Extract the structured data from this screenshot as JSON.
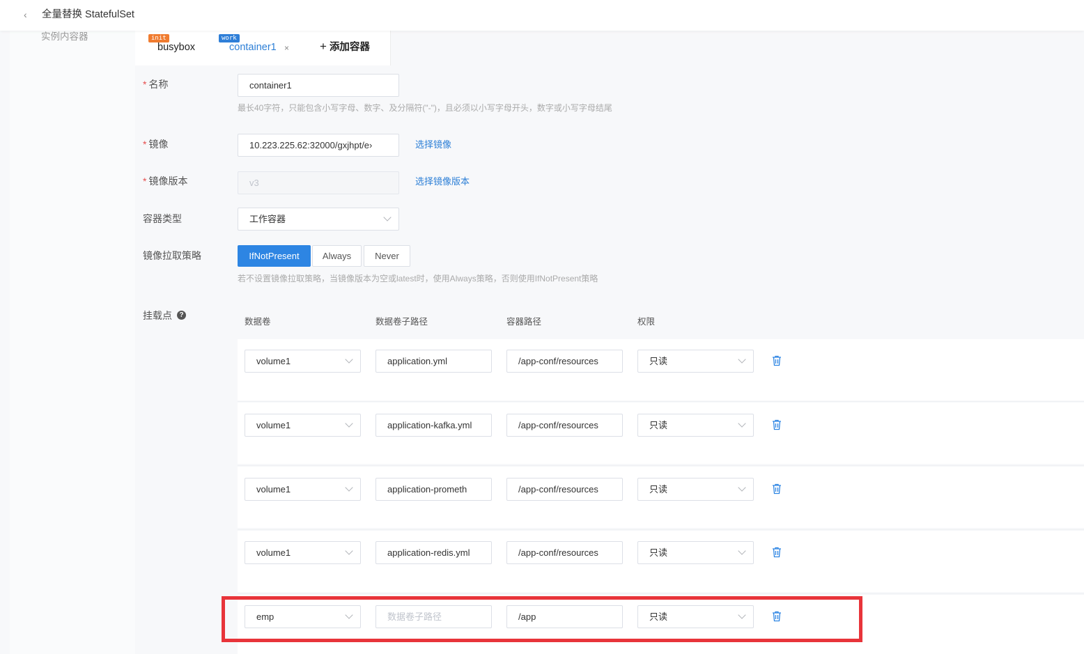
{
  "header": {
    "title": "全量替换 StatefulSet"
  },
  "left_nav": {
    "item": "实例内容器"
  },
  "tabs": [
    {
      "badge": "init",
      "label": "busybox",
      "badge_color": "#f07c30"
    },
    {
      "badge": "work",
      "label": "container1",
      "badge_color": "#2f7fd8",
      "close": "×"
    }
  ],
  "add_container": {
    "plus": "+",
    "label": "添加容器"
  },
  "form": {
    "name": {
      "required": "*",
      "label": "名称",
      "value": "container1",
      "hint": "最长40字符，只能包含小写字母、数字、及分隔符(\"-\")，且必须以小写字母开头，数字或小写字母结尾"
    },
    "image": {
      "required": "*",
      "label": "镜像",
      "value": "10.223.225.62:32000/gxjhpt/e›",
      "link": "选择镜像"
    },
    "image_version": {
      "required": "*",
      "label": "镜像版本",
      "value": "v3",
      "link": "选择镜像版本"
    },
    "container_type": {
      "label": "容器类型",
      "value": "工作容器"
    },
    "pull_policy": {
      "label": "镜像拉取策略",
      "options": [
        "IfNotPresent",
        "Always",
        "Never"
      ],
      "selected": "IfNotPresent",
      "hint": "若不设置镜像拉取策略，当镜像版本为空或latest时，使用Always策略，否则使用IfNotPresent策略"
    },
    "mounts": {
      "label": "挂载点",
      "help": "?",
      "columns": [
        "数据卷",
        "数据卷子路径",
        "容器路径",
        "权限"
      ],
      "rows": [
        {
          "volume": "volume1",
          "sub_path": "application.yml",
          "sub_path_placeholder": "",
          "container_path": "/app-conf/resources",
          "permission": "只读"
        },
        {
          "volume": "volume1",
          "sub_path": "application-kafka.yml",
          "sub_path_placeholder": "",
          "container_path": "/app-conf/resources",
          "permission": "只读"
        },
        {
          "volume": "volume1",
          "sub_path": "application-prometh",
          "sub_path_placeholder": "",
          "container_path": "/app-conf/resources",
          "permission": "只读"
        },
        {
          "volume": "volume1",
          "sub_path": "application-redis.yml",
          "sub_path_placeholder": "",
          "container_path": "/app-conf/resources",
          "permission": "只读"
        },
        {
          "volume": "emp",
          "sub_path": "",
          "sub_path_placeholder": "数据卷子路径",
          "container_path": "/app",
          "permission": "只读"
        }
      ]
    }
  },
  "colors": {
    "accent": "#2d85e3",
    "required": "#e64e4e",
    "highlight": "#e8343a",
    "link": "#2d7fd6"
  }
}
